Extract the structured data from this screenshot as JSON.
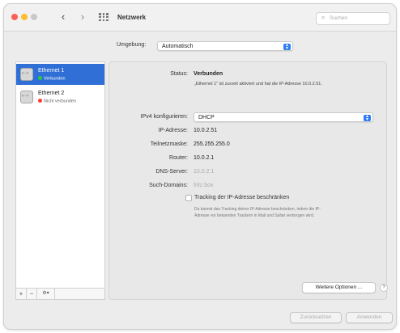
{
  "window": {
    "title": "Netzwerk"
  },
  "toolbar": {
    "back_glyph": "‹",
    "forward_glyph": "›",
    "search_placeholder": "Suchen"
  },
  "location": {
    "label": "Umgebung:",
    "value": "Automatisch"
  },
  "sidebar": {
    "services": [
      {
        "name": "Ethernet 1",
        "status": "Verbunden",
        "status_color": "#28c940",
        "selected": true
      },
      {
        "name": "Ethernet 2",
        "status": "Nicht verbunden",
        "status_color": "#fe3b30",
        "selected": false
      }
    ],
    "add_label": "+",
    "remove_label": "−",
    "action_label": "⚙▾"
  },
  "detail": {
    "status_label": "Status:",
    "status_value": "Verbunden",
    "status_description": "„Ethernet 1\" ist zurzeit aktiviert und hat die IP-Adresse 10.0.2.51.",
    "ipv4_label": "IPv4 konfigurieren:",
    "ipv4_value": "DHCP",
    "ip_label": "IP-Adresse:",
    "ip_value": "10.0.2.51",
    "subnet_label": "Teilnetzmaske:",
    "subnet_value": "255.255.255.0",
    "router_label": "Router:",
    "router_value": "10.0.2.1",
    "dns_label": "DNS-Server:",
    "dns_value": "10.0.2.1",
    "search_domains_label": "Such-Domains:",
    "search_domains_value": "fritz.box",
    "tracking_label": "Tracking der IP-Adresse beschränken",
    "tracking_checked": false,
    "tracking_help_line1": "Du kannst das Tracking deiner IP-Adresse beschränken, indem die IP-",
    "tracking_help_line2": "Adresse vor bekannten Trackern in Mail und Safari verborgen wird.",
    "more_options_label": "Weitere Optionen ...",
    "help_label": "?"
  },
  "footer": {
    "revert_label": "Zurücksetzen",
    "apply_label": "Anwenden"
  }
}
